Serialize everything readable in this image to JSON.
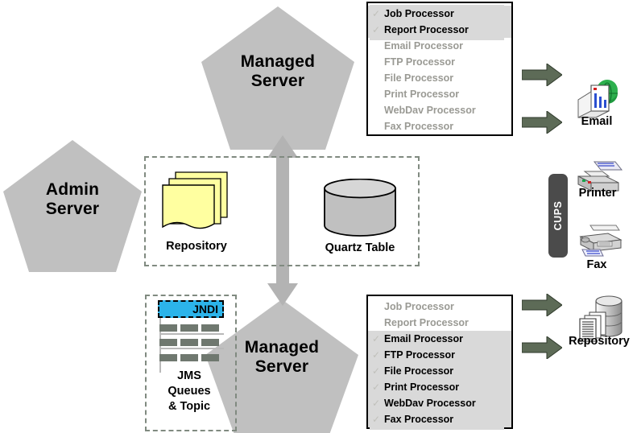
{
  "diagram": {
    "title": "Managed Server architecture diagram",
    "colors": {
      "pentagon_fill": "#c0c0c0",
      "dashed_border": "#808a80",
      "arrow_fill": "#5d6b57",
      "highlight_row": "#d9d9d9",
      "jndi_fill": "#2cb4ea",
      "cups_fill": "#4b4b4b",
      "repository_paper": "#ffffa0",
      "quartz_fill": "#c0c0c0"
    }
  },
  "nodes": {
    "admin_server": {
      "label": "Admin\nServer"
    },
    "managed_server_top": {
      "label": "Managed\nServer"
    },
    "managed_server_bottom": {
      "label": "Managed\nServer"
    }
  },
  "shared_box": {
    "repository": {
      "label": "Repository"
    },
    "quartz_table": {
      "label": "Quartz Table"
    }
  },
  "jms_box": {
    "jndi_label": "JNDI",
    "caption": "JMS\nQueues\n& Topic"
  },
  "processor_list_top": {
    "items": [
      {
        "label": "Job Processor",
        "enabled": true
      },
      {
        "label": "Report Processor",
        "enabled": true
      },
      {
        "label": "Email Processor",
        "enabled": false
      },
      {
        "label": "FTP Processor",
        "enabled": false
      },
      {
        "label": "File Processor",
        "enabled": false
      },
      {
        "label": "Print Processor",
        "enabled": false
      },
      {
        "label": "WebDav Processor",
        "enabled": false
      },
      {
        "label": "Fax Processor",
        "enabled": false
      }
    ]
  },
  "processor_list_bottom": {
    "items": [
      {
        "label": "Job Processor",
        "enabled": false
      },
      {
        "label": "Report Processor",
        "enabled": false
      },
      {
        "label": "Email Processor",
        "enabled": true
      },
      {
        "label": "FTP Processor",
        "enabled": true
      },
      {
        "label": "File Processor",
        "enabled": true
      },
      {
        "label": "Print Processor",
        "enabled": true
      },
      {
        "label": "WebDav Processor",
        "enabled": true
      },
      {
        "label": "Fax Processor",
        "enabled": true
      }
    ]
  },
  "external": {
    "email": {
      "label": "Email"
    },
    "cups": {
      "label": "CUPS"
    },
    "printer": {
      "label": "Printer"
    },
    "fax": {
      "label": "Fax"
    },
    "repository": {
      "label": "Repository"
    }
  },
  "checkmark": "✓"
}
